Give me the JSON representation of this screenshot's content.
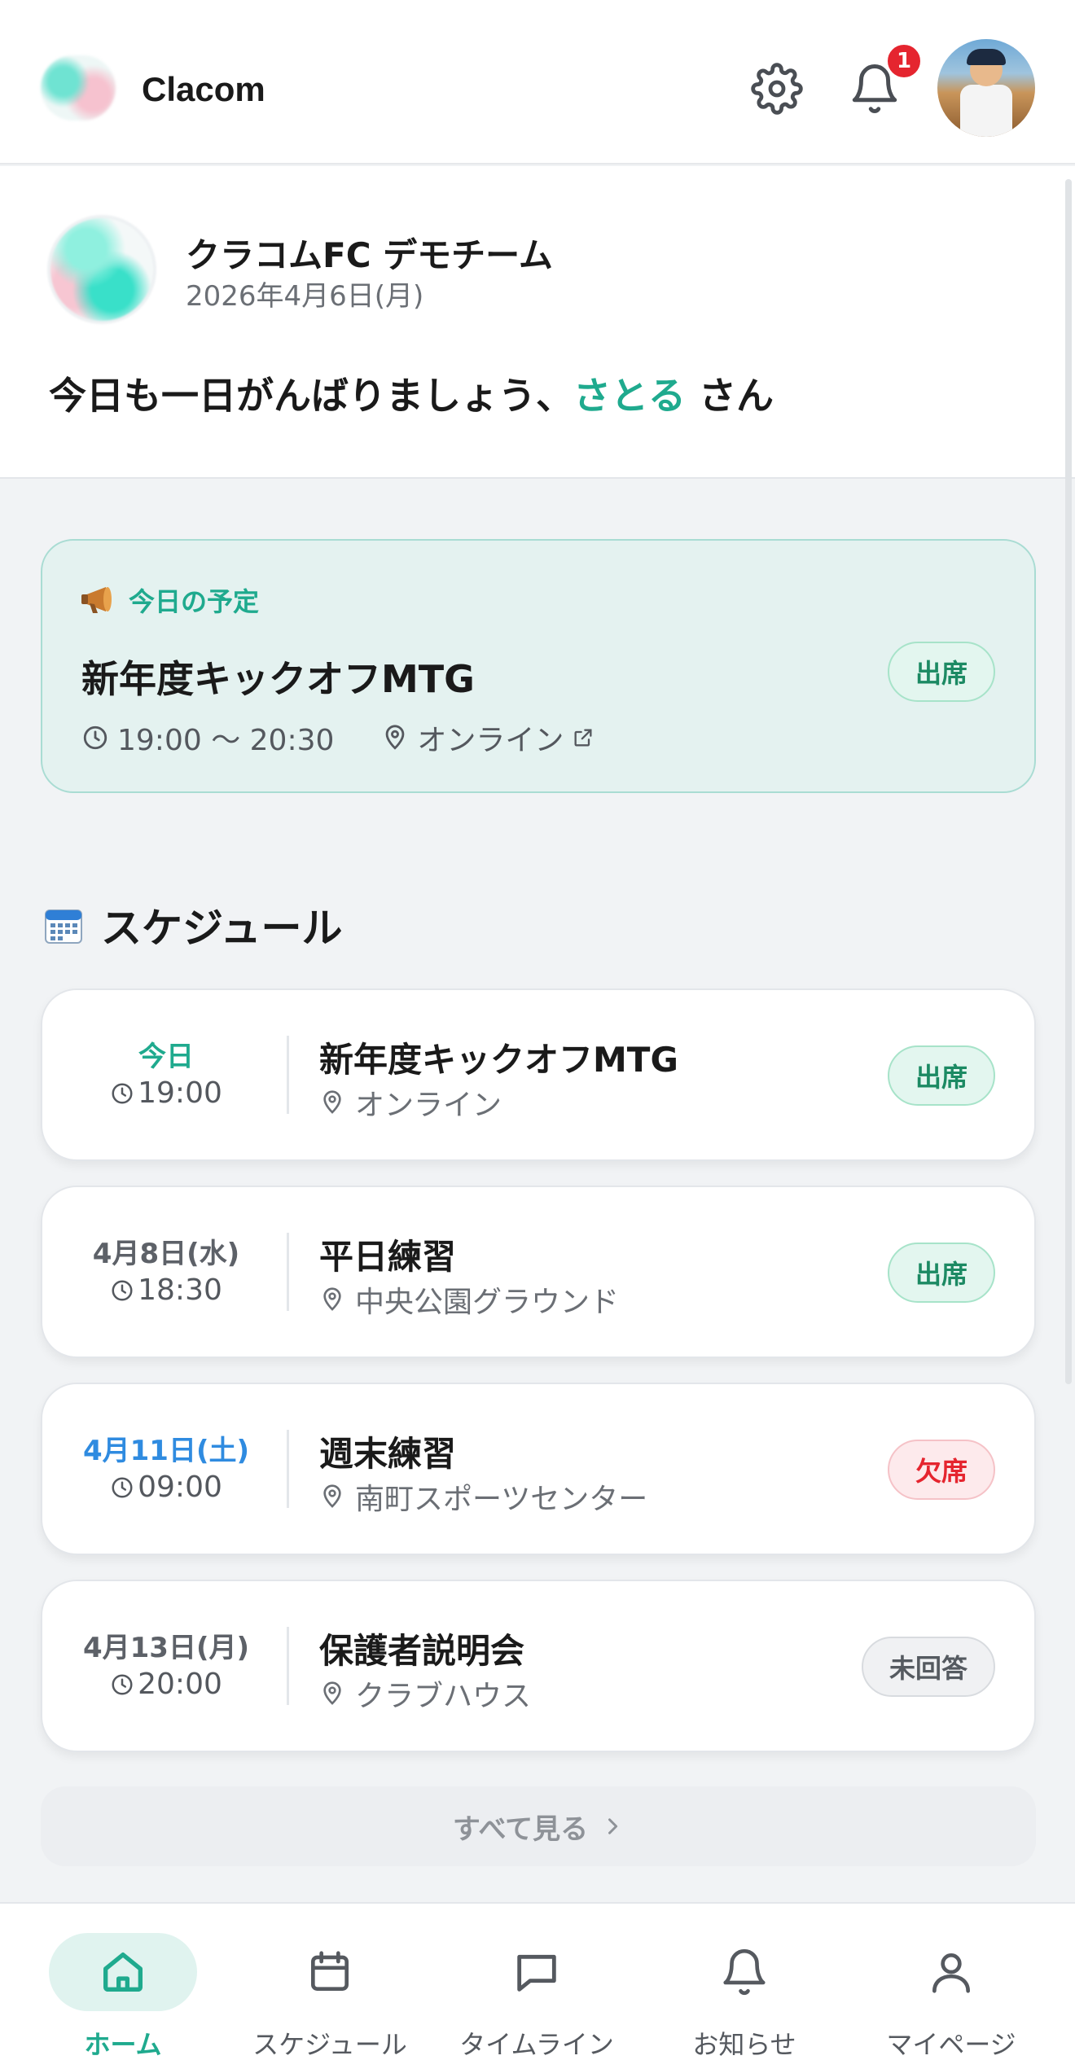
{
  "app": {
    "name": "Clacom",
    "notification_count": "1"
  },
  "team": {
    "name": "クラコムFC デモチーム",
    "date": "2026年4月6日(月)",
    "greeting_prefix": "今日も一日がんばりましょう、",
    "user_name": "さとる",
    "greeting_suffix": " さん"
  },
  "today": {
    "label": "今日の予定",
    "title": "新年度キックオフMTG",
    "time": "19:00 〜 20:30",
    "location": "オンライン",
    "status": "出席"
  },
  "schedule": {
    "title": "スケジュール",
    "items": [
      {
        "date": "今日",
        "time": "19:00",
        "title": "新年度キックオフMTG",
        "place": "オンライン",
        "status": "出席"
      },
      {
        "date": "4月8日(水)",
        "time": "18:30",
        "title": "平日練習",
        "place": "中央公園グラウンド",
        "status": "出席"
      },
      {
        "date": "4月11日(土)",
        "time": "09:00",
        "title": "週末練習",
        "place": "南町スポーツセンター",
        "status": "欠席"
      },
      {
        "date": "4月13日(月)",
        "time": "20:00",
        "title": "保護者説明会",
        "place": "クラブハウス",
        "status": "未回答"
      }
    ],
    "see_all": "すべて見る"
  },
  "nav": {
    "items": [
      {
        "label": "ホーム",
        "icon": "home-icon"
      },
      {
        "label": "スケジュール",
        "icon": "calendar-icon"
      },
      {
        "label": "タイムライン",
        "icon": "chat-icon"
      },
      {
        "label": "お知らせ",
        "icon": "bell-icon"
      },
      {
        "label": "マイページ",
        "icon": "user-icon"
      }
    ]
  },
  "colors": {
    "accent": "#1faa8e",
    "attend": "#1c8a63",
    "absent": "#e5252f",
    "saturday": "#2f8be0",
    "badge": "#e5252f"
  }
}
